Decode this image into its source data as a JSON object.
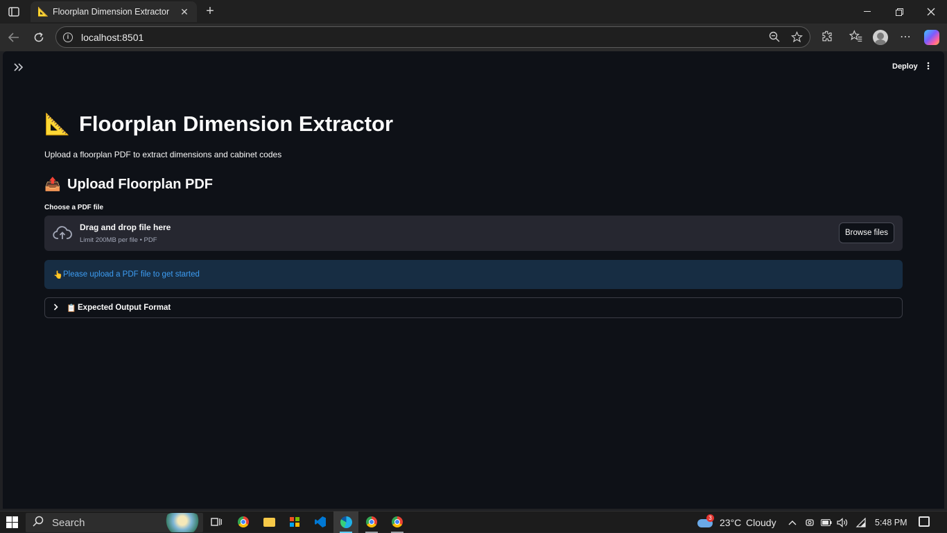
{
  "browser": {
    "tab_title": "Floorplan Dimension Extractor",
    "tab_favicon": "📐",
    "url": "localhost:8501"
  },
  "app": {
    "header": {
      "deploy_label": "Deploy"
    },
    "title_emoji": "📐",
    "title": "Floorplan Dimension Extractor",
    "caption": "Upload a floorplan PDF to extract dimensions and cabinet codes",
    "upload_section": {
      "emoji": "📤",
      "heading": "Upload Floorplan PDF",
      "label": "Choose a PDF file",
      "drop_text": "Drag and drop file here",
      "limit_text": "Limit 200MB per file • PDF",
      "browse_label": "Browse files"
    },
    "info_alert": {
      "emoji": "👆",
      "text": "Please upload a PDF file to get started"
    },
    "expander": {
      "emoji": "📋",
      "label": "Expected Output Format"
    }
  },
  "taskbar": {
    "search_placeholder": "Search",
    "weather_temp": "23°C",
    "weather_condition": "Cloudy",
    "weather_badge": "3",
    "time": "5:48 PM"
  },
  "colors": {
    "app_bg": "#0e1117",
    "dropzone_bg": "#262730",
    "info_bg": "#172d43",
    "info_text": "#3d9df3"
  }
}
